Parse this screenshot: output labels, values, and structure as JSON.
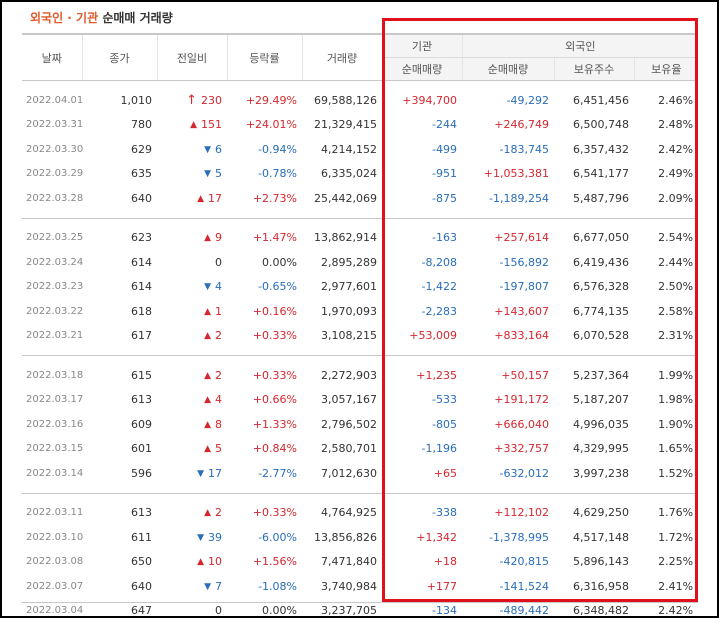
{
  "title": {
    "foreign": "외국인",
    "sep": " · ",
    "inst": "기관",
    "rest": " 순매매 거래량"
  },
  "headers": {
    "date": "날짜",
    "close": "종가",
    "change": "전일비",
    "rate": "등락률",
    "volume": "거래량",
    "inst_group": "기관",
    "foreign_group": "외국인",
    "inst_net": "순매매량",
    "foreign_net": "순매매량",
    "foreign_shares": "보유주수",
    "foreign_ratio": "보유율"
  },
  "colors": {
    "up": "#d6262e",
    "down": "#2a6dbb",
    "highlight_box": "#e0101c",
    "title_accent": "#e05a2a"
  },
  "groups": [
    [
      {
        "date": "2022.04.01",
        "close": "1,010",
        "dir": "upper",
        "change": "230",
        "rate": "+29.49%",
        "volume": "69,588,126",
        "inst": "+394,700",
        "foreign": "-49,292",
        "shares": "6,451,456",
        "ratio": "2.46%"
      },
      {
        "date": "2022.03.31",
        "close": "780",
        "dir": "up",
        "change": "151",
        "rate": "+24.01%",
        "volume": "21,329,415",
        "inst": "-244",
        "foreign": "+246,749",
        "shares": "6,500,748",
        "ratio": "2.48%"
      },
      {
        "date": "2022.03.30",
        "close": "629",
        "dir": "down",
        "change": "6",
        "rate": "-0.94%",
        "volume": "4,214,152",
        "inst": "-499",
        "foreign": "-183,745",
        "shares": "6,357,432",
        "ratio": "2.42%"
      },
      {
        "date": "2022.03.29",
        "close": "635",
        "dir": "down",
        "change": "5",
        "rate": "-0.78%",
        "volume": "6,335,024",
        "inst": "-951",
        "foreign": "+1,053,381",
        "shares": "6,541,177",
        "ratio": "2.49%"
      },
      {
        "date": "2022.03.28",
        "close": "640",
        "dir": "up",
        "change": "17",
        "rate": "+2.73%",
        "volume": "25,442,069",
        "inst": "-875",
        "foreign": "-1,189,254",
        "shares": "5,487,796",
        "ratio": "2.09%"
      }
    ],
    [
      {
        "date": "2022.03.25",
        "close": "623",
        "dir": "up",
        "change": "9",
        "rate": "+1.47%",
        "volume": "13,862,914",
        "inst": "-163",
        "foreign": "+257,614",
        "shares": "6,677,050",
        "ratio": "2.54%"
      },
      {
        "date": "2022.03.24",
        "close": "614",
        "dir": "flat",
        "change": "0",
        "rate": "0.00%",
        "volume": "2,895,289",
        "inst": "-8,208",
        "foreign": "-156,892",
        "shares": "6,419,436",
        "ratio": "2.44%"
      },
      {
        "date": "2022.03.23",
        "close": "614",
        "dir": "down",
        "change": "4",
        "rate": "-0.65%",
        "volume": "2,977,601",
        "inst": "-1,422",
        "foreign": "-197,807",
        "shares": "6,576,328",
        "ratio": "2.50%"
      },
      {
        "date": "2022.03.22",
        "close": "618",
        "dir": "up",
        "change": "1",
        "rate": "+0.16%",
        "volume": "1,970,093",
        "inst": "-2,283",
        "foreign": "+143,607",
        "shares": "6,774,135",
        "ratio": "2.58%"
      },
      {
        "date": "2022.03.21",
        "close": "617",
        "dir": "up",
        "change": "2",
        "rate": "+0.33%",
        "volume": "3,108,215",
        "inst": "+53,009",
        "foreign": "+833,164",
        "shares": "6,070,528",
        "ratio": "2.31%"
      }
    ],
    [
      {
        "date": "2022.03.18",
        "close": "615",
        "dir": "up",
        "change": "2",
        "rate": "+0.33%",
        "volume": "2,272,903",
        "inst": "+1,235",
        "foreign": "+50,157",
        "shares": "5,237,364",
        "ratio": "1.99%"
      },
      {
        "date": "2022.03.17",
        "close": "613",
        "dir": "up",
        "change": "4",
        "rate": "+0.66%",
        "volume": "3,057,167",
        "inst": "-533",
        "foreign": "+191,172",
        "shares": "5,187,207",
        "ratio": "1.98%"
      },
      {
        "date": "2022.03.16",
        "close": "609",
        "dir": "up",
        "change": "8",
        "rate": "+1.33%",
        "volume": "2,796,502",
        "inst": "-805",
        "foreign": "+666,040",
        "shares": "4,996,035",
        "ratio": "1.90%"
      },
      {
        "date": "2022.03.15",
        "close": "601",
        "dir": "up",
        "change": "5",
        "rate": "+0.84%",
        "volume": "2,580,701",
        "inst": "-1,196",
        "foreign": "+332,757",
        "shares": "4,329,995",
        "ratio": "1.65%"
      },
      {
        "date": "2022.03.14",
        "close": "596",
        "dir": "down",
        "change": "17",
        "rate": "-2.77%",
        "volume": "7,012,630",
        "inst": "+65",
        "foreign": "-632,012",
        "shares": "3,997,238",
        "ratio": "1.52%"
      }
    ],
    [
      {
        "date": "2022.03.11",
        "close": "613",
        "dir": "up",
        "change": "2",
        "rate": "+0.33%",
        "volume": "4,764,925",
        "inst": "-338",
        "foreign": "+112,102",
        "shares": "4,629,250",
        "ratio": "1.76%"
      },
      {
        "date": "2022.03.10",
        "close": "611",
        "dir": "down",
        "change": "39",
        "rate": "-6.00%",
        "volume": "13,856,826",
        "inst": "+1,342",
        "foreign": "-1,378,995",
        "shares": "4,517,148",
        "ratio": "1.72%"
      },
      {
        "date": "2022.03.08",
        "close": "650",
        "dir": "up",
        "change": "10",
        "rate": "+1.56%",
        "volume": "7,471,840",
        "inst": "+18",
        "foreign": "-420,815",
        "shares": "5,896,143",
        "ratio": "2.25%"
      },
      {
        "date": "2022.03.07",
        "close": "640",
        "dir": "down",
        "change": "7",
        "rate": "-1.08%",
        "volume": "3,740,984",
        "inst": "+177",
        "foreign": "-141,524",
        "shares": "6,316,958",
        "ratio": "2.41%"
      },
      {
        "date": "2022.03.04",
        "close": "647",
        "dir": "flat",
        "change": "0",
        "rate": "0.00%",
        "volume": "3,237,705",
        "inst": "-134",
        "foreign": "-489,442",
        "shares": "6,348,482",
        "ratio": "2.42%"
      }
    ]
  ]
}
